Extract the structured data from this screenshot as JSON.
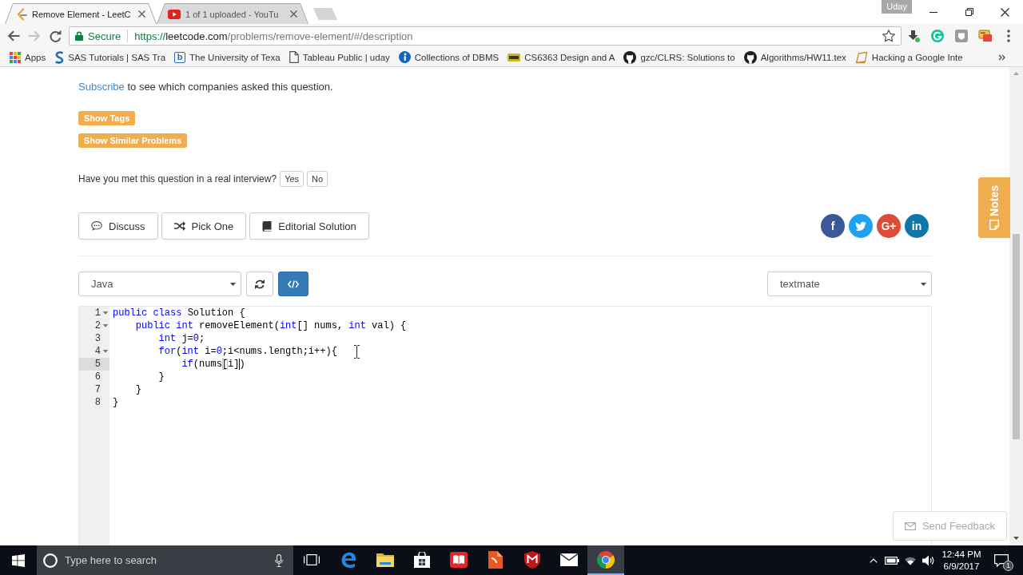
{
  "browser": {
    "tabs": [
      {
        "title": "Remove Element - LeetC",
        "kind": "code",
        "selected": true
      },
      {
        "title": "1 of 1 uploaded - YouTu",
        "kind": "video",
        "selected": false
      }
    ],
    "profile": "Uday",
    "nav_buttons": [
      {
        "kind": "back",
        "disabled": false
      },
      {
        "kind": "forward",
        "disabled": true
      },
      {
        "kind": "reload",
        "disabled": false
      }
    ],
    "security_label": "Secure",
    "url": {
      "scheme": "https://",
      "host": "leetcode.com",
      "path": "/problems/remove-element/#/description"
    },
    "bookmarked": false,
    "bookmarks": [
      {
        "label": "Apps",
        "kind": "grid"
      },
      {
        "label": "SAS Tutorials | SAS Tra",
        "kind": "swirl"
      },
      {
        "label": "The University of Texa",
        "kind": "letter",
        "glyph": "b"
      },
      {
        "label": "Tableau Public | uday",
        "kind": "page"
      },
      {
        "label": "Collections of DBMS",
        "kind": "info"
      },
      {
        "label": "CS6363 Design and A",
        "kind": "tag"
      },
      {
        "label": "gzc/CLRS: Solutions to",
        "kind": "cat"
      },
      {
        "label": "Algorithms/HW11.tex",
        "kind": "cat"
      },
      {
        "label": "Hacking a Google Inte",
        "kind": "note"
      }
    ]
  },
  "page": {
    "subscribe_note": {
      "link": "Subscribe",
      "text": " to see which companies asked this question."
    },
    "tag_buttons": [
      "Show Tags",
      "Show Similar Problems"
    ],
    "interview": {
      "question": "Have you met this question in a real interview?",
      "answers": [
        "Yes",
        "No"
      ]
    },
    "actions": [
      {
        "kind": "discuss",
        "label": "Discuss"
      },
      {
        "kind": "shuffle",
        "label": "Pick One"
      },
      {
        "kind": "book",
        "label": "Editorial Solution"
      }
    ],
    "share_buttons": [
      {
        "kind": "letter",
        "glyph": "f",
        "color": "#3b5998"
      },
      {
        "kind": "bird",
        "color": "#1da1f2"
      },
      {
        "kind": "letter",
        "glyph": "G+",
        "color": "#dd4b39"
      },
      {
        "kind": "letter",
        "glyph": "in",
        "color": "#0e76a8"
      }
    ],
    "language_select": "Java",
    "theme_select": "textmate",
    "editor": {
      "lines": [
        {
          "line_number": "1",
          "foldable": true,
          "active": false,
          "tokens": [
            {
              "kind": "keyword",
              "text": "public"
            },
            {
              "kind": "keyword",
              "text": " class"
            },
            {
              "kind": "plain",
              "text": " Solution {"
            }
          ]
        },
        {
          "line_number": "2",
          "foldable": true,
          "active": false,
          "tokens": [
            {
              "kind": "keyword",
              "text": "    public"
            },
            {
              "kind": "keyword",
              "text": " int"
            },
            {
              "kind": "plain",
              "text": " removeElement("
            },
            {
              "kind": "keyword",
              "text": "int"
            },
            {
              "kind": "plain",
              "text": "[] nums, "
            },
            {
              "kind": "keyword",
              "text": "int"
            },
            {
              "kind": "plain",
              "text": " val) {"
            }
          ]
        },
        {
          "line_number": "3",
          "foldable": false,
          "active": false,
          "tokens": [
            {
              "kind": "keyword",
              "text": "        int"
            },
            {
              "kind": "plain",
              "text": " j="
            },
            {
              "kind": "number",
              "text": "0"
            },
            {
              "kind": "plain",
              "text": ";"
            }
          ]
        },
        {
          "line_number": "4",
          "foldable": true,
          "active": false,
          "tokens": [
            {
              "kind": "keyword",
              "text": "        for"
            },
            {
              "kind": "plain",
              "text": "("
            },
            {
              "kind": "keyword",
              "text": "int"
            },
            {
              "kind": "plain",
              "text": " i="
            },
            {
              "kind": "number",
              "text": "0"
            },
            {
              "kind": "plain",
              "text": ";i<nums.length;i++){"
            }
          ]
        },
        {
          "line_number": "5",
          "foldable": false,
          "active": true,
          "tokens": [
            {
              "kind": "keyword",
              "text": "            if"
            },
            {
              "kind": "plain",
              "text": "(nums"
            },
            {
              "kind": "bracket_match",
              "text": "["
            },
            {
              "kind": "plain",
              "text": "i]"
            },
            {
              "kind": "caret"
            },
            {
              "kind": "plain",
              "text": ")"
            }
          ]
        },
        {
          "line_number": "6",
          "foldable": false,
          "active": false,
          "tokens": [
            {
              "kind": "plain",
              "text": "        }"
            }
          ]
        },
        {
          "line_number": "7",
          "foldable": false,
          "active": false,
          "tokens": [
            {
              "kind": "plain",
              "text": "    }"
            }
          ]
        },
        {
          "line_number": "8",
          "foldable": false,
          "active": false,
          "tokens": [
            {
              "kind": "plain",
              "text": "}"
            }
          ]
        }
      ]
    },
    "notes_tab": "Notes",
    "feedback_button": "Send Feedback"
  },
  "taskbar": {
    "search_placeholder": "Type here to search",
    "apps": [
      {
        "kind": "taskview",
        "selected": false
      },
      {
        "kind": "ebrowser",
        "selected": false
      },
      {
        "kind": "folder",
        "selected": false
      },
      {
        "kind": "store",
        "selected": false
      },
      {
        "kind": "reader",
        "selected": false
      },
      {
        "kind": "document",
        "selected": false
      },
      {
        "kind": "shield",
        "selected": false
      },
      {
        "kind": "mail",
        "selected": false
      },
      {
        "kind": "orb",
        "selected": true
      }
    ],
    "clock": {
      "time": "12:44 PM",
      "date": "6/9/2017"
    },
    "notification_count": "1"
  }
}
